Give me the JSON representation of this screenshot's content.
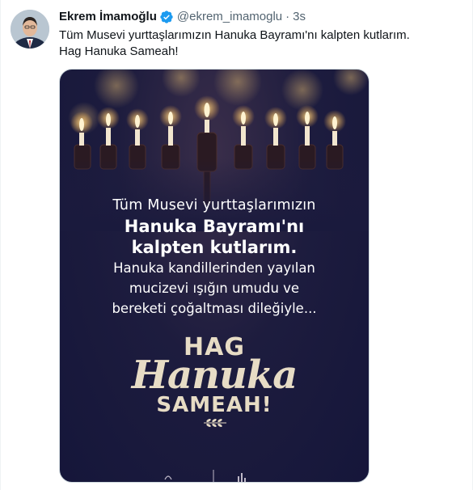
{
  "tweet": {
    "author_name": "Ekrem İmamoğlu",
    "handle": "@ekrem_imamoglu",
    "separator": "·",
    "time": "3s",
    "text_line1": "Tüm Musevi yurttaşlarımızın Hanuka Bayramı'nı kalpten kutlarım.",
    "text_line2": "Hag Hanuka Sameah!",
    "verified_icon": "verified-badge-icon",
    "colors": {
      "text": "#0f1419",
      "secondary": "#536471",
      "verified": "#1d9bf0",
      "card_background": "#1d1c3e",
      "card_accent": "#e7dcc5"
    }
  },
  "media": {
    "line1": "Tüm Musevi yurttaşlarımızın",
    "line2": "Hanuka Bayramı'nı",
    "line3": "kalpten kutlarım.",
    "line4": "Hanuka kandillerinden yayılan",
    "line5": "mucizevi ışığın umudu ve",
    "line6": "bereketi çoğaltması dileğiyle...",
    "hag": "HAG",
    "hanuka": "Hanuka",
    "sameah": "SAMEAH!"
  }
}
